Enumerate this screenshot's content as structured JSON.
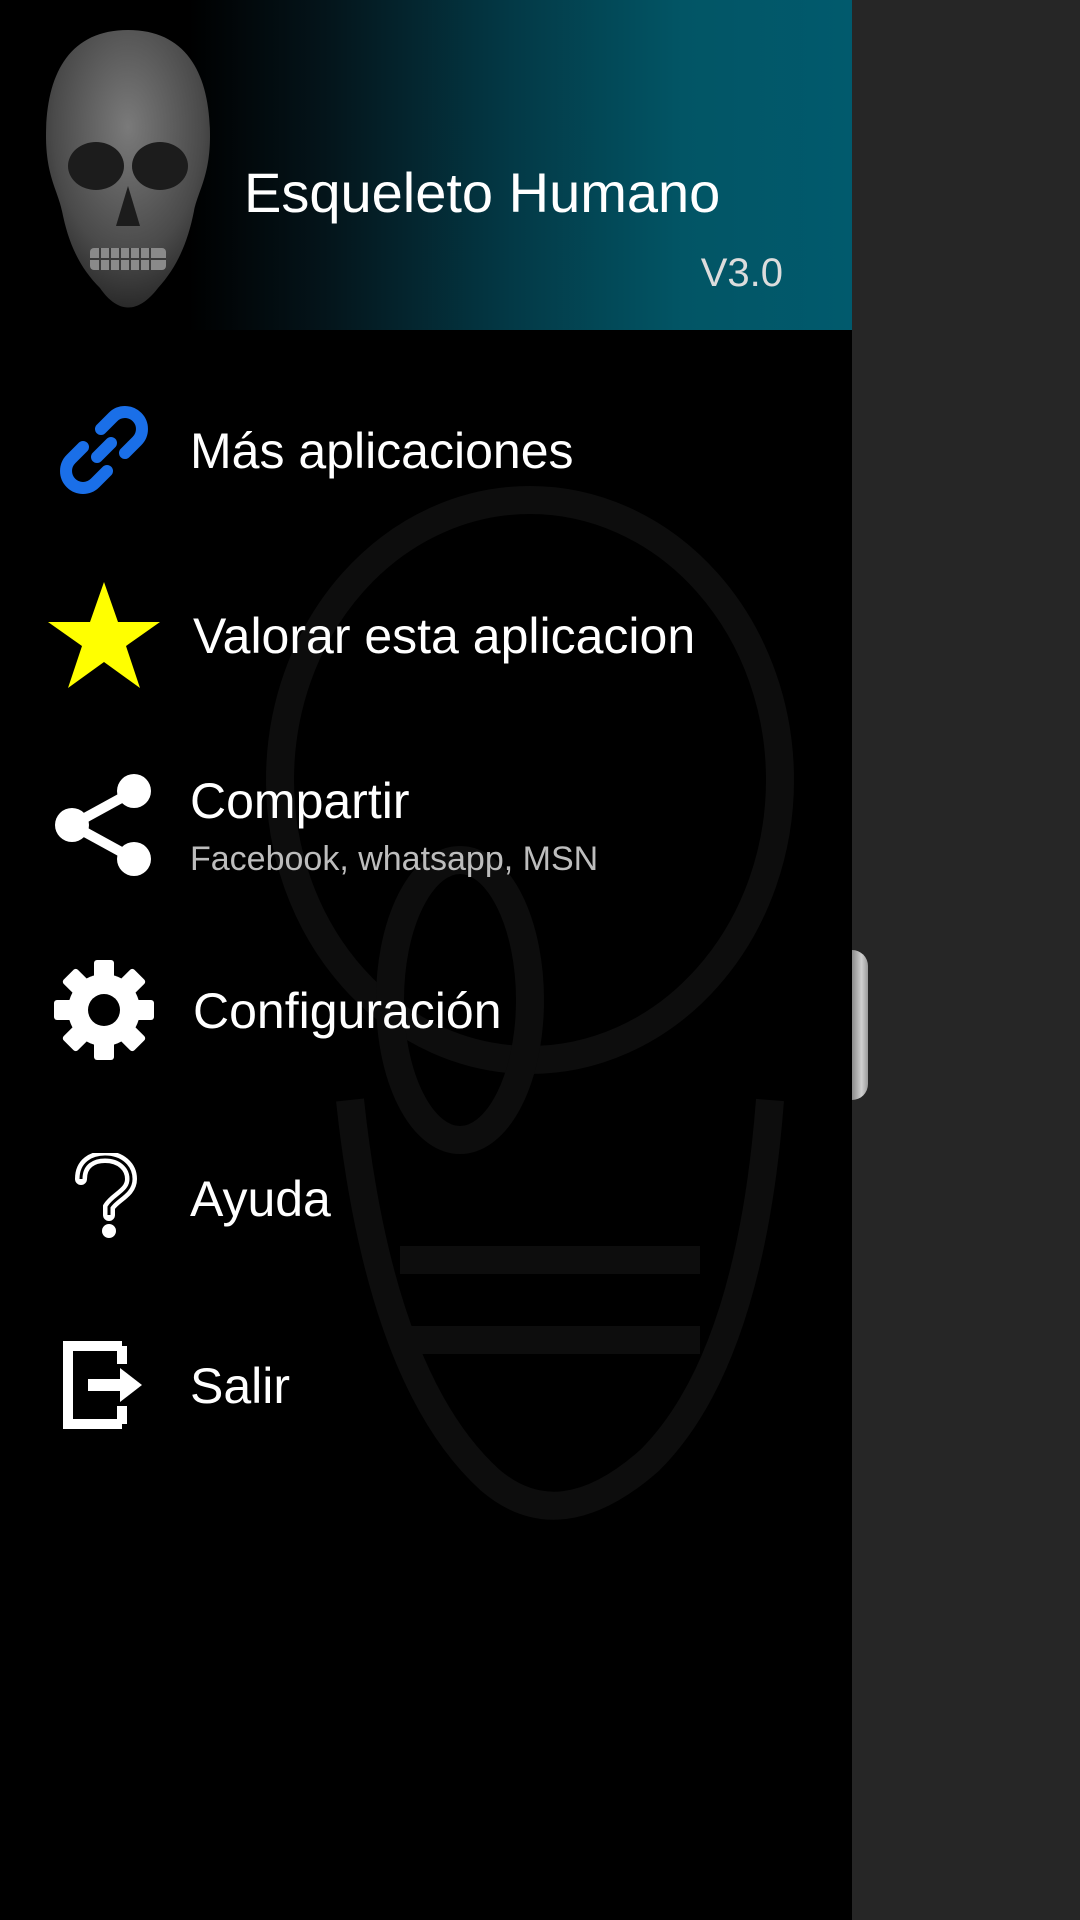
{
  "header": {
    "title": "Esqueleto Humano",
    "version": "V3.0",
    "logo_icon": "skull-icon"
  },
  "menu": {
    "items": [
      {
        "id": "more-apps",
        "label": "Más aplicaciones",
        "icon": "link-icon",
        "icon_color": "#1a6fe8"
      },
      {
        "id": "rate",
        "label": "Valorar esta aplicacion",
        "icon": "star-icon",
        "icon_color": "#ffff00"
      },
      {
        "id": "share",
        "label": "Compartir",
        "sublabel": "Facebook, whatsapp, MSN",
        "icon": "share-icon",
        "icon_color": "#ffffff"
      },
      {
        "id": "settings",
        "label": "Configuración",
        "icon": "gear-icon",
        "icon_color": "#ffffff"
      },
      {
        "id": "help",
        "label": "Ayuda",
        "icon": "question-icon",
        "icon_color": "#ffffff"
      },
      {
        "id": "exit",
        "label": "Salir",
        "icon": "exit-icon",
        "icon_color": "#ffffff"
      }
    ]
  },
  "colors": {
    "drawer_background": "#000000",
    "scrim": "#262626",
    "header_accent": "#015a6d"
  }
}
